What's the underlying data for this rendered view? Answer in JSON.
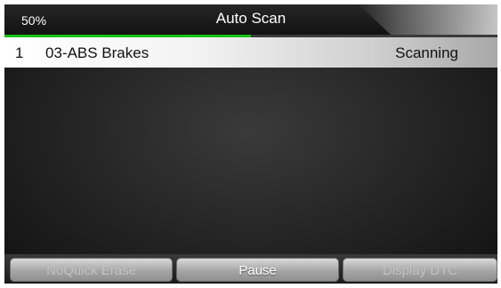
{
  "header": {
    "progress_label": "50%",
    "progress_fraction": 0.5,
    "title": "Auto Scan"
  },
  "scan_list": [
    {
      "index": "1",
      "module": "03-ABS Brakes",
      "status": "Scanning"
    }
  ],
  "buttons": {
    "left_label": "NoQuick Erase",
    "middle_label": "Pause",
    "right_label": "Display DTC"
  },
  "colors": {
    "progress_fill": "#16c318",
    "background": "#232323"
  }
}
